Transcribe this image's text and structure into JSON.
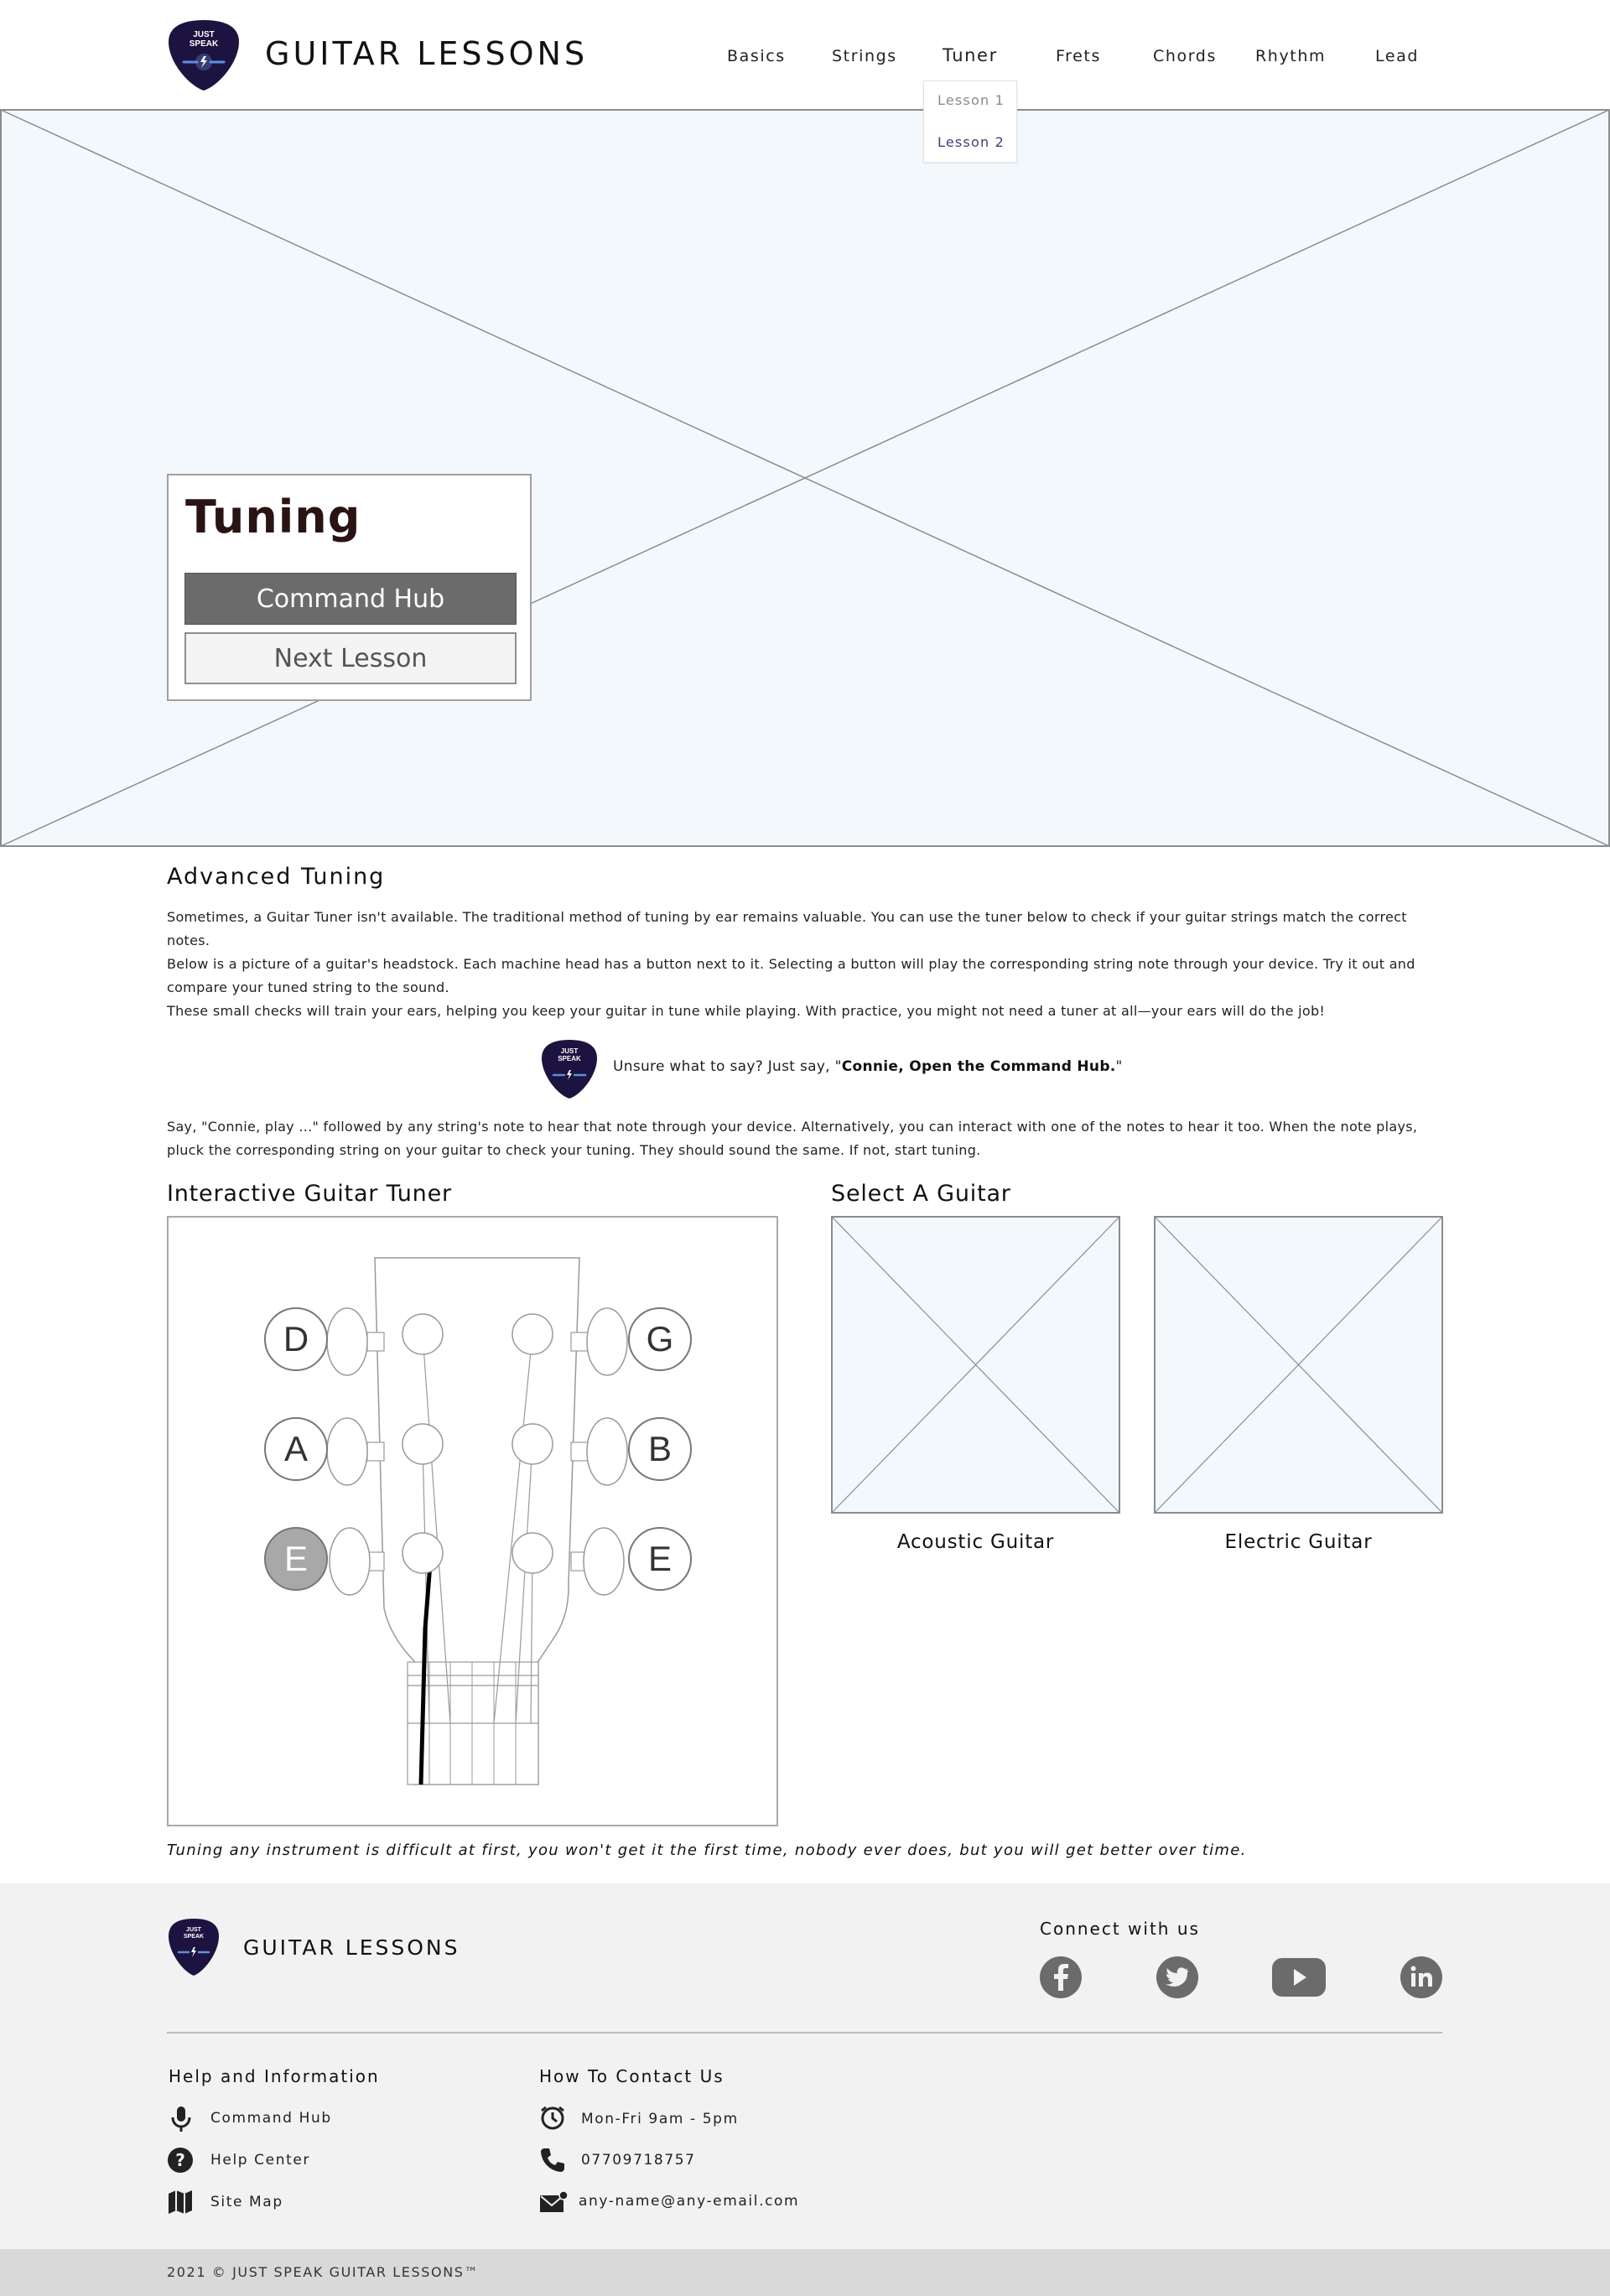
{
  "header": {
    "brand": "GUITAR LESSONS",
    "logo_text": [
      "JUST",
      "SPEAK"
    ],
    "nav": [
      "Basics",
      "Strings",
      "Tuner",
      "Frets",
      "Chords",
      "Rhythm",
      "Lead"
    ],
    "active_nav": "Tuner",
    "dropdown": [
      "Lesson 1",
      "Lesson 2"
    ]
  },
  "hero": {
    "title": "Tuning",
    "primary_button": "Command Hub",
    "secondary_button": "Next Lesson"
  },
  "main": {
    "section_title": "Advanced Tuning",
    "paragraphs": [
      "Sometimes, a Guitar Tuner isn't available. The traditional method of tuning by ear remains valuable. You can use the tuner below to check if your guitar strings match the correct notes.",
      "Below is a picture of a guitar's headstock. Each machine head has a button next to it. Selecting a button will play the corresponding string note through your device. Try it out and compare your tuned string to the sound.",
      "These small checks will train your ears, helping you keep your guitar in tune while playing. With practice, you might not need a tuner at all—your ears will do the job!"
    ],
    "tip_prefix": "Unsure what to say? Just say, \"",
    "tip_command": "Connie, Open the Command Hub.",
    "tip_suffix": "\"",
    "instructions": "Say, \"Connie, play ...\" followed by any string's note to hear that note through your device. Alternatively, you can interact with one of the notes to hear it too. When the note plays, pluck the corresponding string on your guitar to check your tuning. They should sound the same. If not, start tuning.",
    "tuner_title": "Interactive Guitar Tuner",
    "select_title": "Select A Guitar",
    "notes_left": [
      "D",
      "A",
      "E"
    ],
    "notes_right": [
      "G",
      "B",
      "E"
    ],
    "active_note": "E (low)",
    "guitars": [
      "Acoustic Guitar",
      "Electric Guitar"
    ],
    "quote": "Tuning any instrument is difficult at first, you won't get it the first time, nobody ever does, but you will get better over time."
  },
  "footer": {
    "brand": "GUITAR LESSONS",
    "connect_title": "Connect with us",
    "social": [
      "facebook-icon",
      "twitter-icon",
      "youtube-icon",
      "linkedin-icon"
    ],
    "help_title": "Help and Information",
    "help_items": [
      "Command Hub",
      "Help Center",
      "Site Map"
    ],
    "contact_title": "How To Contact Us",
    "contact_items": [
      "Mon-Fri 9am - 5pm",
      "07709718757",
      "any-name@any-email.com"
    ],
    "copyright": "2021 © JUST SPEAK GUITAR LESSONS™"
  },
  "colors": {
    "logo_bg": "#1d1340",
    "logo_accent": "#5b8fe0",
    "placeholder_bg": "#f3f8fd",
    "footer_bg": "#f2f2f2",
    "copyright_bg": "#d9d9d9",
    "active_note_bg": "#a8a8a8"
  }
}
